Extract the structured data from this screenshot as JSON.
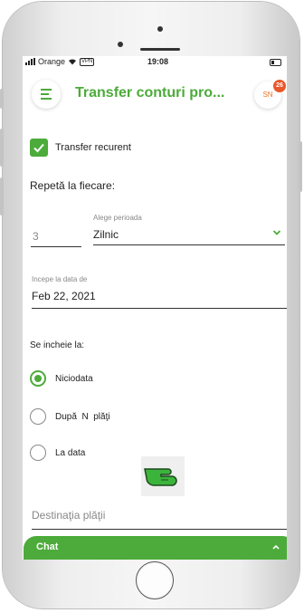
{
  "status_bar": {
    "carrier": "Orange",
    "vpn": "VPN",
    "time": "19:08"
  },
  "header": {
    "title": "Transfer conturi pro...",
    "avatar_initials": "SN",
    "notification_count": "26"
  },
  "form": {
    "recurring": {
      "label": "Transfer recurent",
      "checked": true
    },
    "repeat_label": "Repetă la fiecare:",
    "repeat_count": "3",
    "period": {
      "label": "Alege perioada",
      "value": "Zilnic"
    },
    "start_date": {
      "label": "Incepe la data de",
      "value": "Feb 22, 2021"
    },
    "ends_label": "Se incheie la:",
    "end_options": [
      {
        "label": "Niciodata",
        "selected": true
      },
      {
        "label": "După  N  plăţi",
        "selected": false
      },
      {
        "label": "La data",
        "selected": false
      }
    ],
    "destination_placeholder": "Destinaţia plăţii"
  },
  "chat": {
    "label": "Chat"
  },
  "icons": {
    "menu": "hamburger-menu-icon",
    "dropdown": "chevron-down-icon",
    "pointer": "pointing-hand-icon",
    "chat_toggle": "chevron-up-icon"
  },
  "colors": {
    "accent": "#4cab3a",
    "badge": "#e9572b"
  }
}
